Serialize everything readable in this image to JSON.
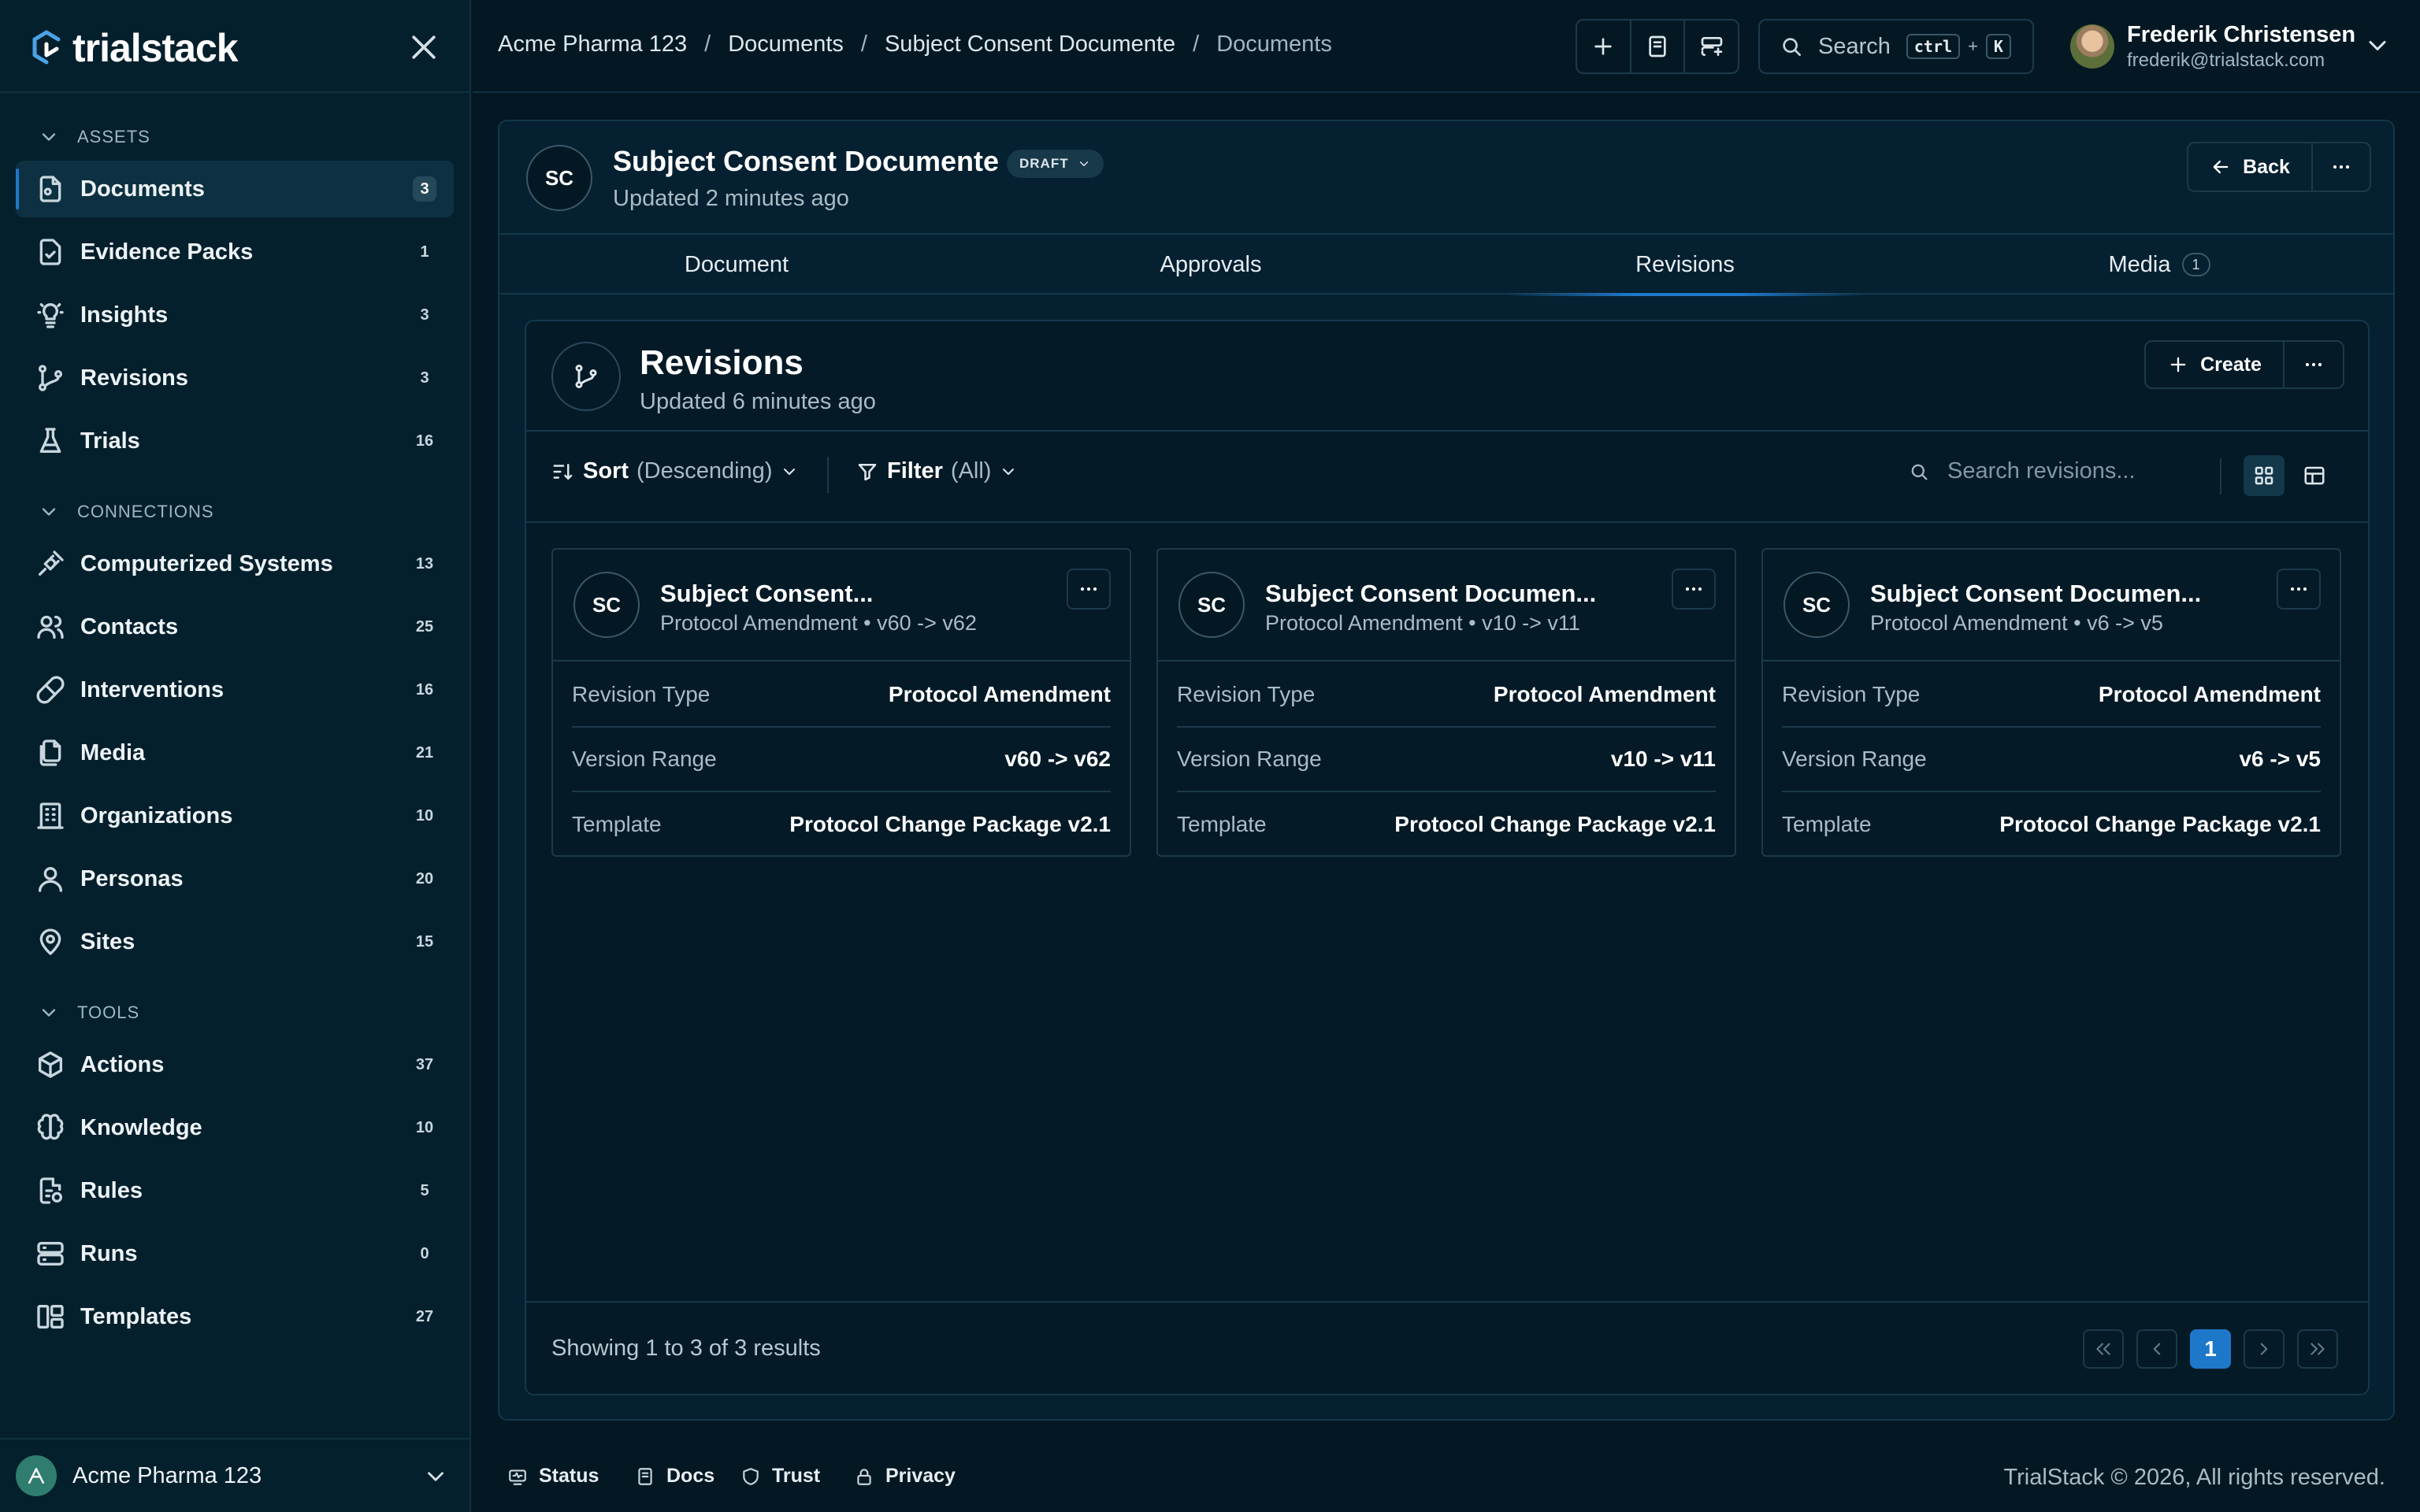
{
  "app": {
    "name": "trialstack"
  },
  "sidebar": {
    "sections": {
      "assets": "ASSETS",
      "connections": "CONNECTIONS",
      "tools": "TOOLS"
    },
    "items": [
      {
        "label": "Documents",
        "count": "3",
        "icon": "document-icon"
      },
      {
        "label": "Evidence Packs",
        "count": "1",
        "icon": "file-check-icon"
      },
      {
        "label": "Insights",
        "count": "3",
        "icon": "lightbulb-icon"
      },
      {
        "label": "Revisions",
        "count": "3",
        "icon": "git-branch-icon"
      },
      {
        "label": "Trials",
        "count": "16",
        "icon": "flask-icon"
      },
      {
        "label": "Computerized Systems",
        "count": "13",
        "icon": "plug-icon"
      },
      {
        "label": "Contacts",
        "count": "25",
        "icon": "users-icon"
      },
      {
        "label": "Interventions",
        "count": "16",
        "icon": "pill-icon"
      },
      {
        "label": "Media",
        "count": "21",
        "icon": "files-icon"
      },
      {
        "label": "Organizations",
        "count": "10",
        "icon": "building-icon"
      },
      {
        "label": "Personas",
        "count": "20",
        "icon": "user-icon"
      },
      {
        "label": "Sites",
        "count": "15",
        "icon": "map-pin-icon"
      },
      {
        "label": "Actions",
        "count": "37",
        "icon": "box-icon"
      },
      {
        "label": "Knowledge",
        "count": "10",
        "icon": "brain-icon"
      },
      {
        "label": "Rules",
        "count": "5",
        "icon": "file-rules-icon"
      },
      {
        "label": "Runs",
        "count": "0",
        "icon": "server-icon"
      },
      {
        "label": "Templates",
        "count": "27",
        "icon": "template-icon"
      }
    ],
    "org_name": "Acme Pharma 123"
  },
  "topbar": {
    "breadcrumb": [
      "Acme Pharma 123",
      "Documents",
      "Subject Consent Documente",
      "Documents"
    ],
    "search_label": "Search",
    "kbd_ctrl": "ctrl",
    "kbd_plus": "+",
    "kbd_k": "K",
    "user_name": "Frederik Christensen",
    "user_email": "frederik@trialstack.com"
  },
  "document": {
    "initials": "SC",
    "title": "Subject Consent Documente",
    "status": "DRAFT",
    "updated": "Updated 2 minutes ago",
    "back_label": "Back",
    "tabs": [
      {
        "label": "Document"
      },
      {
        "label": "Approvals"
      },
      {
        "label": "Revisions"
      },
      {
        "label": "Media",
        "badge": "1"
      }
    ],
    "active_tab": "Revisions"
  },
  "revisions": {
    "title": "Revisions",
    "updated": "Updated 6 minutes ago",
    "create_label": "Create",
    "sort_label": "Sort",
    "sort_value": "(Descending)",
    "filter_label": "Filter",
    "filter_value": "(All)",
    "search_placeholder": "Search revisions...",
    "row_labels": {
      "type": "Revision Type",
      "range": "Version Range",
      "template": "Template"
    },
    "cards": [
      {
        "initials": "SC",
        "title": "Subject Consent...",
        "subtitle": "Protocol Amendment • v60 -> v62",
        "type": "Protocol Amendment",
        "range": "v60 -> v62",
        "template": "Protocol Change Package v2.1"
      },
      {
        "initials": "SC",
        "title": "Subject Consent Documen...",
        "subtitle": "Protocol Amendment • v10 -> v11",
        "type": "Protocol Amendment",
        "range": "v10 -> v11",
        "template": "Protocol Change Package v2.1"
      },
      {
        "initials": "SC",
        "title": "Subject Consent Documen...",
        "subtitle": "Protocol Amendment • v6 -> v5",
        "type": "Protocol Amendment",
        "range": "v6 -> v5",
        "template": "Protocol Change Package v2.1"
      }
    ],
    "results_text": "Showing 1 to 3 of 3 results",
    "current_page": "1"
  },
  "footer": {
    "links": [
      "Status",
      "Docs",
      "Trust",
      "Privacy"
    ],
    "copyright": "TrialStack © 2026, All rights reserved."
  },
  "colors": {
    "accent": "#1e78c9",
    "background": "#041823",
    "sidebar": "#05202d"
  }
}
